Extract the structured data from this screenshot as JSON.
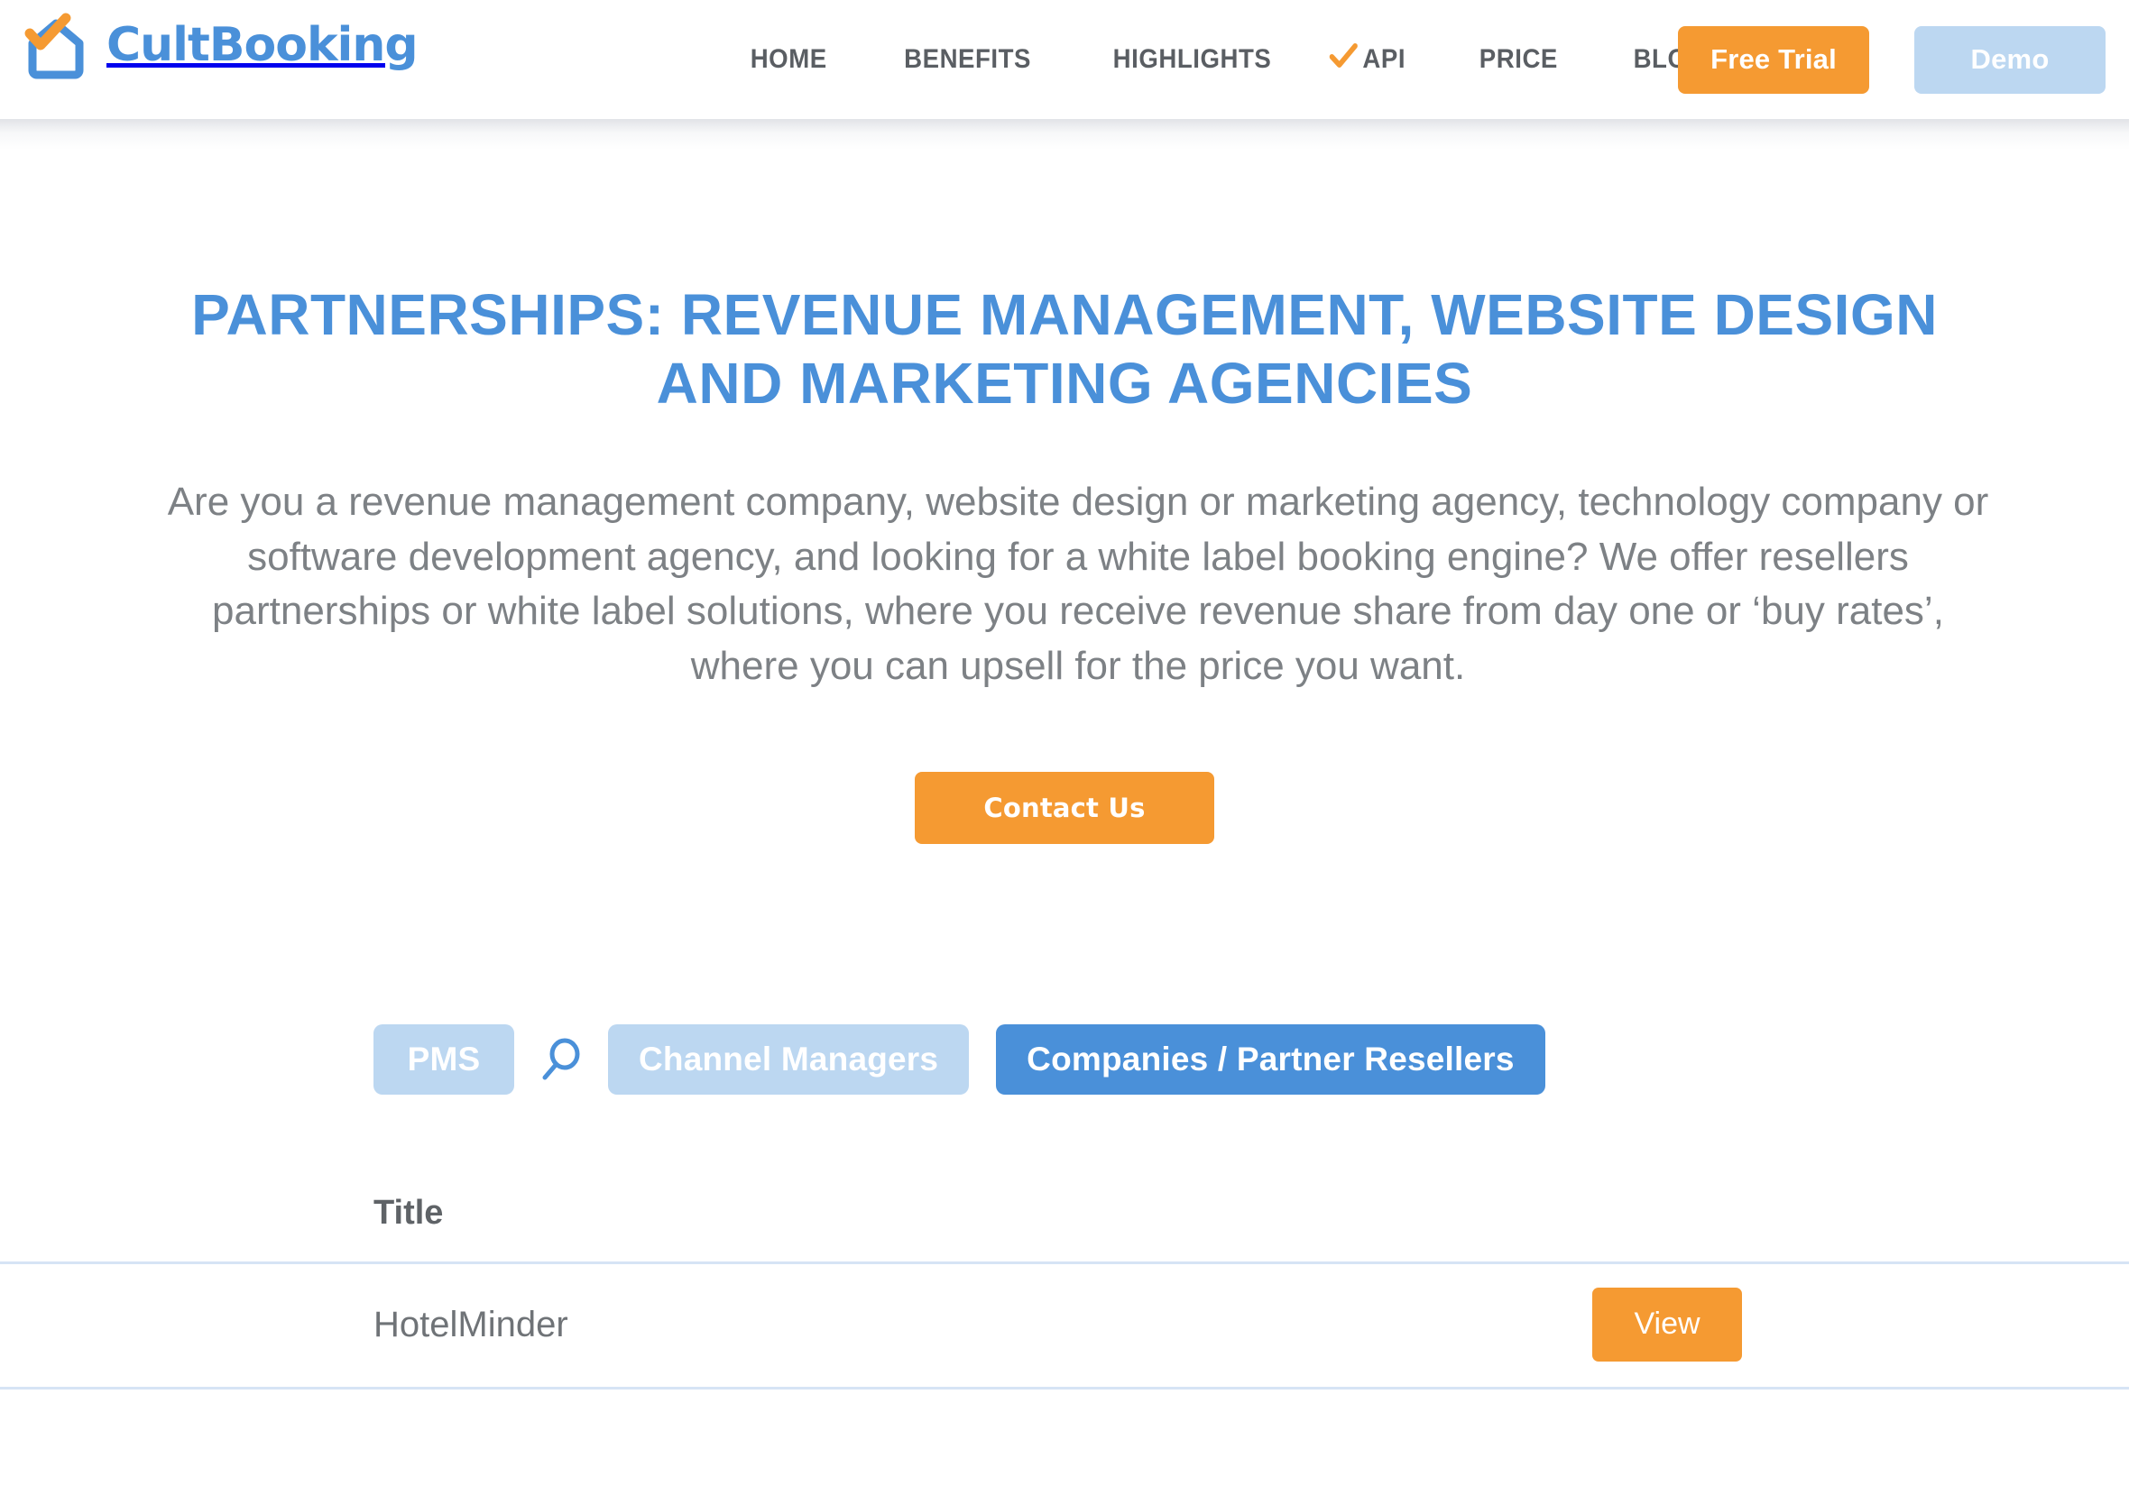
{
  "header": {
    "logo": {
      "brand_text": "CultBooking",
      "mark_name": "house-check-logo"
    },
    "nav": [
      {
        "label": "HOME",
        "has_check": false
      },
      {
        "label": "BENEFITS",
        "has_check": false
      },
      {
        "label": "HIGHLIGHTS",
        "has_check": false
      },
      {
        "label": "API",
        "has_check": true
      },
      {
        "label": "PRICE",
        "has_check": false
      },
      {
        "label": "BLOG",
        "has_check": false
      }
    ],
    "free_trial_label": "Free Trial",
    "demo_label": "Demo"
  },
  "hero": {
    "title": "PARTNERSHIPS: REVENUE MANAGEMENT, WEBSITE DESIGN AND MARKETING AGENCIES",
    "paragraph": "Are you a revenue management company, website design or marketing agency, technology company or software development agency, and looking for a white label booking engine? We offer resellers partnerships or white label solutions, where you receive revenue share from day one or ‘buy rates’, where you can upsell for the price you want.",
    "contact_label": "Contact Us"
  },
  "tabs": {
    "items": [
      {
        "label": "PMS",
        "active": false
      },
      {
        "label": "Channel Managers",
        "active": false
      },
      {
        "label": "Companies / Partner Resellers",
        "active": true
      }
    ],
    "search_icon": "search-icon"
  },
  "table": {
    "columns": [
      "Title",
      ""
    ],
    "rows": [
      {
        "title": "HotelMinder",
        "action_label": "View"
      }
    ]
  },
  "colors": {
    "brand_blue": "#4a90d9",
    "light_blue": "#BCD7F1",
    "accent_orange": "#F59A32",
    "nav_text": "#5a5e63",
    "body_text": "#7d8185",
    "row_border": "#D6E4F5"
  }
}
